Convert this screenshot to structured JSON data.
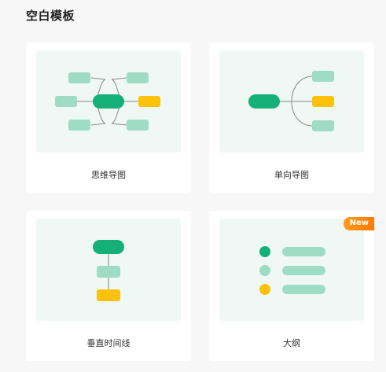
{
  "section": {
    "title": "空白模板"
  },
  "templates": [
    {
      "label": "思维导图",
      "icon": "mindmap-icon"
    },
    {
      "label": "单向导图",
      "icon": "one-way-map-icon"
    },
    {
      "label": "垂直时间线",
      "icon": "vertical-timeline-icon"
    },
    {
      "label": "大纲",
      "icon": "outline-icon",
      "badge": "New"
    }
  ],
  "colors": {
    "primary": "#15b07a",
    "light": "#9fdcc6",
    "accent": "#fcc10a",
    "preview_bg": "#eff8f4",
    "badge": "#ff8a10"
  }
}
